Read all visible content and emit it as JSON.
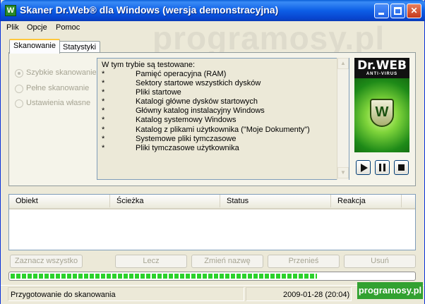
{
  "window": {
    "title": "Skaner Dr.Web® dla Windows (wersja demonstracyjna)",
    "icon": "W"
  },
  "menu": [
    "Plik",
    "Opcje",
    "Pomoc"
  ],
  "tabs": [
    "Skanowanie",
    "Statystyki"
  ],
  "scan_modes": [
    {
      "label": "Szybkie skanowanie",
      "checked": true
    },
    {
      "label": "Pełne skanowanie",
      "checked": false
    },
    {
      "label": "Ustawienia własne",
      "checked": false
    }
  ],
  "info": {
    "heading": "W tym trybie są testowane:",
    "bullet": "*",
    "items": [
      "Pamięć operacyjna (RAM)",
      "Sektory startowe wszystkich dysków",
      "Pliki startowe",
      "Katalogi główne dysków startowych",
      "Główny katalog instalacyjny Windows",
      "Katalog systemowy Windows",
      "Katalog z plikami użytkownika (\"Moje Dokumenty\")",
      "Systemowe pliki tymczasowe",
      "Pliki tymczasowe użytkownika"
    ]
  },
  "logo": {
    "name": "Dr.WEB",
    "subtitle": "ANTI-VIRUS",
    "mark": "W"
  },
  "controls": {
    "play": "play-icon",
    "pause": "pause-icon",
    "stop": "stop-icon"
  },
  "list": {
    "columns": [
      "Obiekt",
      "Ścieżka",
      "Status",
      "Reakcja"
    ]
  },
  "buttons": {
    "select_all": "Zaznacz wszystko",
    "cure": "Lecz",
    "rename": "Zmień nazwę",
    "move": "Przenieś",
    "delete": "Usuń"
  },
  "progress": {
    "value": 0.76
  },
  "status": {
    "text": "Przygotowanie do skanowania",
    "datetime": "2009-01-28 (20:04)"
  },
  "watermark": {
    "badge": "programosy.pl",
    "background": "programosy.pl"
  }
}
